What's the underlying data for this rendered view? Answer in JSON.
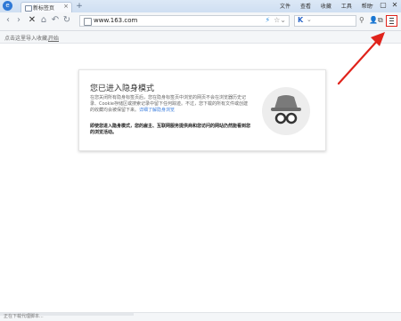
{
  "tab": {
    "title": "新标签页",
    "close": "×"
  },
  "new_tab": "+",
  "system_menu": [
    "文件",
    "查看",
    "收藏",
    "工具",
    "帮助"
  ],
  "window_buttons": {
    "minimize": "–",
    "restore": "▢",
    "close": "✕"
  },
  "nav": {
    "back": "‹",
    "forward": "›",
    "stop": "✕",
    "home": "⌂",
    "undo": "↶",
    "reload": "↻"
  },
  "address_bar": {
    "url": "www.163.com",
    "star": "☆",
    "dropdown": "⌄"
  },
  "search_engine": {
    "logo": "K",
    "caret": "⌄"
  },
  "bookmarks_bar": {
    "hint": "点击这里导入收藏。",
    "link": "开始"
  },
  "incognito": {
    "title": "您已进入隐身模式",
    "body": "在您关闭所有隐身标签页后，您在隐身标签页中浏览的网页不会在浏览器历史记录、Cookie存储区或搜索记录中留下任何踪迹。不过，您下载的所有文件或创建的收藏均会被保留下来。",
    "learn_more": "详细了解隐身浏览",
    "note": "即使您进入隐身模式，您的雇主、互联网服务提供商和您访问的网站仍然能看到您的浏览活动。"
  },
  "status_bar": {
    "text": "正在下载代理脚本..."
  },
  "colors": {
    "annotation": "#e0231b",
    "accent": "#3b7ddd",
    "tab_bar": "#dce8f6"
  }
}
